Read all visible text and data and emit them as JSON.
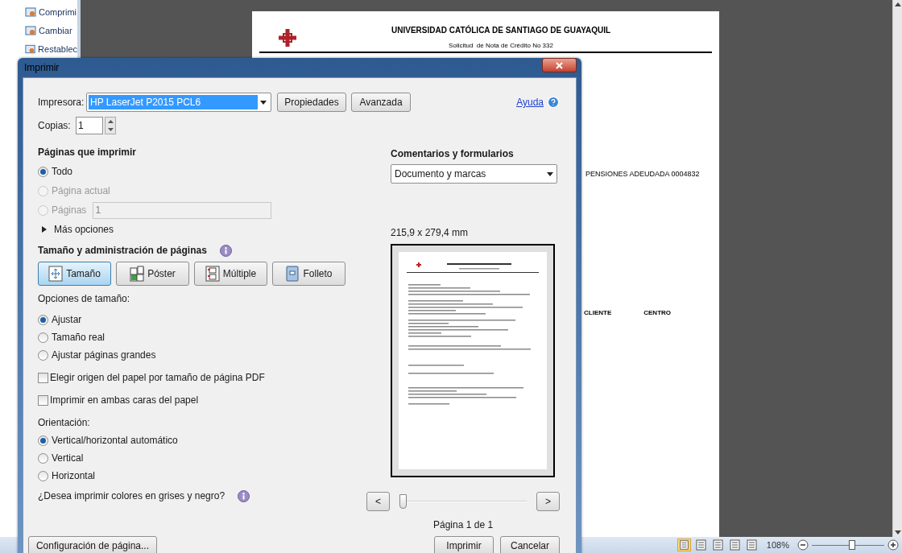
{
  "background_app": {
    "ribbon_items": [
      "Comprimi",
      "Cambiar",
      "Restablec"
    ],
    "document": {
      "title": "UNIVERSIDAD CATÓLICA DE SANTIAGO DE GUAYAQUIL",
      "subtitle": "Solicitud  de Nota de Crédito No 332",
      "line": "PENSIONES ADEUDADA 0004832",
      "columns": [
        "CLIENTE",
        "CENTRO"
      ]
    },
    "status_bar": {
      "views": [
        {
          "selected": true
        },
        {
          "selected": false
        },
        {
          "selected": false
        },
        {
          "selected": false
        },
        {
          "selected": false
        }
      ],
      "zoom": "108%",
      "level": 0.55
    }
  },
  "dialog": {
    "title": "Imprimir",
    "printer": {
      "label": "Impresora:",
      "value": "HP LaserJet P2015 PCL6"
    },
    "buttons": [
      "Propiedades",
      "Avanzada"
    ],
    "help": "Ayuda",
    "copies": {
      "label": "Copias:",
      "value": "1"
    },
    "pages": {
      "title": "Páginas que imprimir",
      "options": [
        {
          "label": "Todo",
          "selected": true,
          "disabled": false
        },
        {
          "label": "Página actual",
          "selected": false,
          "disabled": true
        },
        {
          "label": "Páginas",
          "selected": false,
          "disabled": true
        }
      ],
      "range": "1",
      "more": {
        "label": "Más opciones",
        "expanded": false
      }
    },
    "size_management": {
      "title": "Tamaño y administración de páginas",
      "modes": [
        {
          "label": "Tamaño",
          "kind": "size",
          "selected": true
        },
        {
          "label": "Póster",
          "kind": "poster",
          "selected": false
        },
        {
          "label": "Múltiple",
          "kind": "multiple",
          "selected": false
        },
        {
          "label": "Folleto",
          "kind": "booklet",
          "selected": false
        }
      ],
      "options_label": "Opciones de tamaño:",
      "options": [
        {
          "label": "Ajustar",
          "selected": true
        },
        {
          "label": "Tamaño real",
          "selected": false
        },
        {
          "label": "Ajustar páginas grandes",
          "selected": false
        }
      ],
      "checkboxes": [
        {
          "label": "Elegir origen del papel por tamaño de página PDF",
          "checked": false
        },
        {
          "label": "Imprimir en ambas caras del papel",
          "checked": false
        }
      ]
    },
    "orientation": {
      "label": "Orientación:",
      "options": [
        {
          "label": "Vertical/horizontal automático",
          "selected": true
        },
        {
          "label": "Vertical",
          "selected": false
        },
        {
          "label": "Horizontal",
          "selected": false
        }
      ]
    },
    "grayscale_question": "¿Desea imprimir colores en grises y negro?",
    "comments": {
      "title": "Comentarios y formularios",
      "value": "Documento y marcas"
    },
    "paper_size": "215,9 x 279,4 mm",
    "navigation": {
      "prev": "<",
      "next": ">",
      "level": 0,
      "page": "Página 1 de 1"
    },
    "footer_buttons": [
      {
        "label": "Configuración de página...",
        "kind": "setup"
      },
      {
        "label": "Imprimir",
        "kind": "primary"
      },
      {
        "label": "Cancelar",
        "kind": "cancel"
      }
    ]
  }
}
